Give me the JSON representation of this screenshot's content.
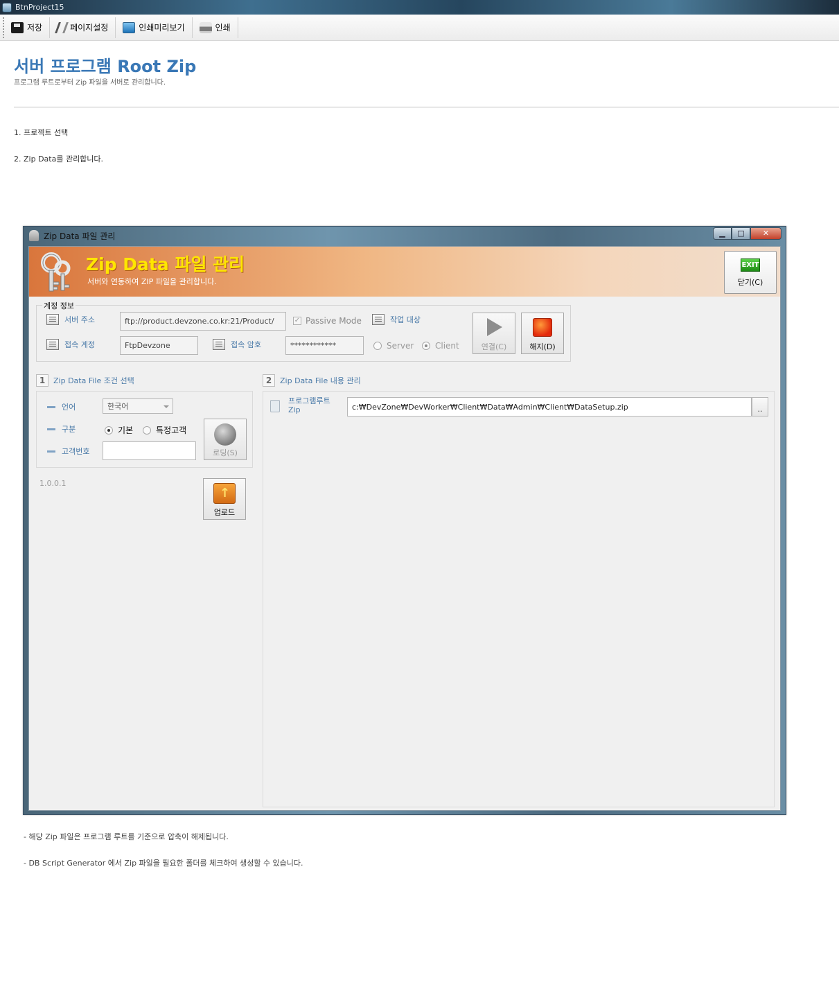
{
  "app": {
    "title": "BtnProject15"
  },
  "toolbar": {
    "save": "저장",
    "page_setup": "페이지설정",
    "print_preview": "인쇄미리보기",
    "print": "인쇄"
  },
  "doc": {
    "title": "서버 프로그램 Root Zip",
    "subtitle": "프로그램 루트로부터 Zip 파일을 서버로 관리합니다.",
    "step1": "1. 프로젝트 선택",
    "step2": "2. Zip Data를 관리합니다.",
    "note1": "- 해당 Zip 파일은 프로그램 루트를 기준으로 압축이 해제됩니다.",
    "note2": "- DB Script Generator 에서 Zip 파일을 필요한 폴더를 체크하여 생성할 수 있습니다."
  },
  "window": {
    "title": "Zip Data 파일 관리",
    "controls": {
      "minimize": "▁",
      "maximize": "□",
      "close": "✕"
    },
    "banner": {
      "title": "Zip Data 파일 관리",
      "subtitle": "서버와 연동하여 ZIP 파일을 관리합니다.",
      "exit_badge": "EXIT",
      "exit_label": "닫기(C)"
    },
    "account": {
      "legend": "계정 정보",
      "server_label": "서버 주소",
      "server_value": "ftp://product.devzone.co.kr:21/Product/",
      "passive_label": "Passive Mode",
      "passive_check": "✓",
      "target_label": "작업 대상",
      "id_label": "접속 계정",
      "id_value": "FtpDevzone",
      "pw_label": "접속 암호",
      "pw_value": "************",
      "opt_server": "Server",
      "opt_client": "Client",
      "connect": "연결(C)",
      "disconnect": "해지(D)"
    },
    "section1": {
      "num": "1",
      "title": "Zip Data File 조건 선택",
      "lang_label": "언어",
      "lang_value": "한국어",
      "type_label": "구분",
      "opt_basic": "기본",
      "opt_custom": "특정고객",
      "cust_label": "고객번호",
      "cust_value": "",
      "load": "로딩(S)",
      "version": "1.0.0.1",
      "upload": "업로드"
    },
    "section2": {
      "num": "2",
      "title": "Zip Data File 내용 관리",
      "zip_label_1": "프로그램루트",
      "zip_label_2": "Zip",
      "zip_path": "c:₩DevZone₩DevWorker₩Client₩Data₩Admin₩Client₩DataSetup.zip",
      "browse": ".."
    }
  }
}
